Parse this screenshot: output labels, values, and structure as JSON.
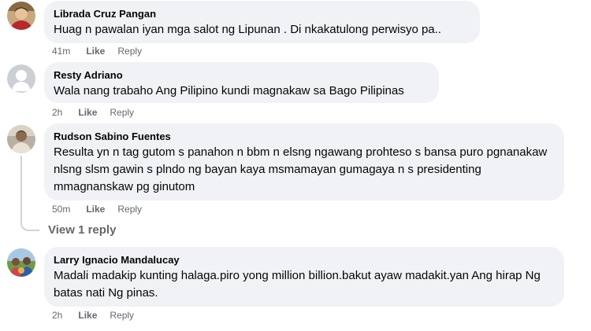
{
  "comments": [
    {
      "author": "Librada Cruz Pangan",
      "text": "Huag n pawalan iyan mga salot ng Lipunan . Di nkakatulong perwisyo pa..",
      "time": "41m",
      "like_label": "Like",
      "reply_label": "Reply"
    },
    {
      "author": "Resty Adriano",
      "text": "Wala nang trabaho Ang Pilipino kundi magnakaw sa Bago Pilipinas",
      "time": "2h",
      "like_label": "Like",
      "reply_label": "Reply"
    },
    {
      "author": "Rudson Sabino Fuentes",
      "text": "Resulta yn n tag gutom s panahon n bbm n elsng ngawang prohteso s bansa puro pgnanakaw nlsng slsm gawin s plndo ng bayan kaya msmamayan gumagaya n s presidenting mmagnanskaw pg ginutom",
      "time": "50m",
      "like_label": "Like",
      "reply_label": "Reply",
      "view_replies": "View 1 reply"
    },
    {
      "author": "Larry Ignacio Mandalucay",
      "text": "Madali madakip kunting halaga.piro yong million billion.bakut ayaw madakit.yan Ang hirap Ng batas nati Ng pinas.",
      "time": "2h",
      "like_label": "Like",
      "reply_label": "Reply"
    }
  ]
}
